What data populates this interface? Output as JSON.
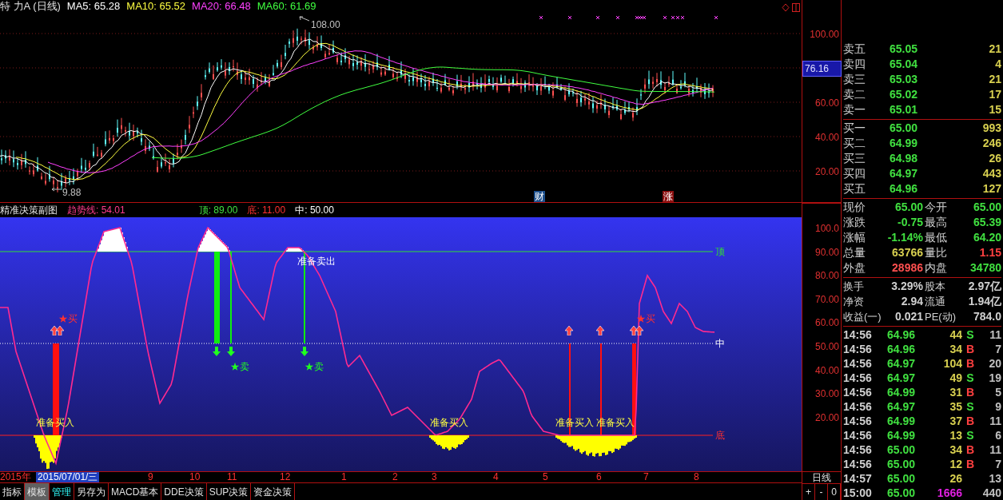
{
  "price_chart": {
    "header": [
      {
        "text": "特 力A (日线)",
        "color": "#e0e0e0"
      },
      {
        "text": "MA5: 65.28",
        "color": "#ffffff"
      },
      {
        "text": "MA10: 65.52",
        "color": "#ffff40"
      },
      {
        "text": "MA20: 66.48",
        "color": "#ff40ff"
      },
      {
        "text": "MA60: 61.69",
        "color": "#40ff40"
      }
    ],
    "high_label": "108.00",
    "low_label": "9.88",
    "event_tags": [
      {
        "text": "财",
        "color": "#1c4f8c"
      },
      {
        "text": "涨",
        "color": "#8c1010"
      }
    ],
    "axis_labels": [
      "100.00",
      "60.00",
      "40.00",
      "20.00"
    ],
    "current_price_tag": "76.16"
  },
  "indicator_chart": {
    "header": [
      {
        "text": "精准决策副图"
      },
      {
        "text": "趋势线: 54.01",
        "color": "#ff3c8c"
      },
      {
        "text": "顶: 89.00",
        "color": "#40e040"
      },
      {
        "text": "底: 11.00",
        "color": "#ff3030"
      },
      {
        "text": "中: 50.00",
        "color": "#ffffff"
      }
    ],
    "line_labels": [
      {
        "kind": "top",
        "text": "顶"
      },
      {
        "kind": "middle",
        "text": "中"
      },
      {
        "kind": "bottom",
        "text": "底"
      }
    ],
    "annotations": [
      {
        "kind": "prep_sell",
        "text": "准备卖出"
      },
      {
        "kind": "prep_buy",
        "text": "准备买入"
      },
      {
        "kind": "prep_buy",
        "text": "准备买入"
      },
      {
        "kind": "prep_buy",
        "text": "准备买入"
      },
      {
        "kind": "prep_buy",
        "text": "准备买入"
      },
      {
        "kind": "sell",
        "text": "★卖"
      },
      {
        "kind": "sell",
        "text": "★卖"
      },
      {
        "kind": "buy",
        "text": "★买"
      },
      {
        "kind": "buy",
        "text": "★买"
      }
    ],
    "axis_labels": [
      "100.0",
      "90.00",
      "80.00",
      "70.00",
      "60.00",
      "50.00",
      "40.00",
      "30.00",
      "20.00"
    ]
  },
  "x_axis": {
    "year": "2015年",
    "cursor_date": "2015/07/01/三",
    "months": [
      "9",
      "10",
      "11",
      "12",
      "1",
      "2",
      "3",
      "4",
      "5",
      "6",
      "7",
      "8"
    ]
  },
  "period_control": {
    "label": "日线",
    "buttons": [
      "+",
      "-",
      "0"
    ]
  },
  "bottom_tabs": [
    {
      "label": "指标",
      "selected": false,
      "active": false
    },
    {
      "label": "模板",
      "selected": true,
      "active": false
    },
    {
      "label": "管理",
      "selected": false,
      "active": true
    },
    {
      "label": "另存为",
      "selected": false,
      "active": false
    },
    {
      "label": "MACD基本",
      "selected": false,
      "active": false
    },
    {
      "label": "DDE决策",
      "selected": false,
      "active": false
    },
    {
      "label": "SUP决策",
      "selected": false,
      "active": false
    },
    {
      "label": "资金决策",
      "selected": false,
      "active": false
    }
  ],
  "order_book": {
    "asks": [
      {
        "label": "卖五",
        "price": "65.05",
        "volume": "21"
      },
      {
        "label": "卖四",
        "price": "65.04",
        "volume": "4"
      },
      {
        "label": "卖三",
        "price": "65.03",
        "volume": "21"
      },
      {
        "label": "卖二",
        "price": "65.02",
        "volume": "17"
      },
      {
        "label": "卖一",
        "price": "65.01",
        "volume": "15"
      }
    ],
    "bids": [
      {
        "label": "买一",
        "price": "65.00",
        "volume": "993"
      },
      {
        "label": "买二",
        "price": "64.99",
        "volume": "246"
      },
      {
        "label": "买三",
        "price": "64.98",
        "volume": "26"
      },
      {
        "label": "买四",
        "price": "64.97",
        "volume": "443"
      },
      {
        "label": "买五",
        "price": "64.96",
        "volume": "127"
      }
    ]
  },
  "quote": [
    {
      "label": "现价",
      "value": "65.00",
      "color": "#40e040"
    },
    {
      "label": "今开",
      "value": "65.00",
      "color": "#40e040"
    },
    {
      "label": "涨跌",
      "value": "-0.75",
      "color": "#40e040"
    },
    {
      "label": "最高",
      "value": "65.39",
      "color": "#40e040"
    },
    {
      "label": "涨幅",
      "value": "-1.14%",
      "color": "#40e040"
    },
    {
      "label": "最低",
      "value": "64.20",
      "color": "#40e040"
    },
    {
      "label": "总量",
      "value": "63766",
      "color": "#d8d050"
    },
    {
      "label": "量比",
      "value": "1.15",
      "color": "#ff4040"
    },
    {
      "label": "外盘",
      "value": "28986",
      "color": "#ff5050"
    },
    {
      "label": "内盘",
      "value": "34780",
      "color": "#40e040"
    }
  ],
  "fundamentals": [
    {
      "label": "换手",
      "value": "3.29%",
      "label2": "股本",
      "value2": "2.97亿"
    },
    {
      "label": "净资",
      "value": "2.94",
      "label2": "流通",
      "value2": "1.94亿"
    },
    {
      "label": "收益(一)",
      "value": "0.021",
      "label2": "PE(动)",
      "value2": "784.0"
    }
  ],
  "trades": [
    {
      "time": "14:56",
      "price": "64.96",
      "volume": "44",
      "side": "S",
      "count": "11",
      "kind": "trade"
    },
    {
      "time": "14:56",
      "price": "64.96",
      "volume": "34",
      "side": "B",
      "count": "7",
      "kind": "trade"
    },
    {
      "time": "14:56",
      "price": "64.97",
      "volume": "104",
      "side": "B",
      "count": "20",
      "kind": "trade"
    },
    {
      "time": "14:56",
      "price": "64.97",
      "volume": "49",
      "side": "S",
      "count": "19",
      "kind": "trade"
    },
    {
      "time": "14:56",
      "price": "64.99",
      "volume": "31",
      "side": "B",
      "count": "5",
      "kind": "trade"
    },
    {
      "time": "14:56",
      "price": "64.97",
      "volume": "35",
      "side": "S",
      "count": "9",
      "kind": "trade"
    },
    {
      "time": "14:56",
      "price": "64.99",
      "volume": "37",
      "side": "B",
      "count": "11",
      "kind": "trade"
    },
    {
      "time": "14:56",
      "price": "64.99",
      "volume": "13",
      "side": "S",
      "count": "6",
      "kind": "trade"
    },
    {
      "time": "14:56",
      "price": "65.00",
      "volume": "34",
      "side": "B",
      "count": "11",
      "kind": "trade"
    },
    {
      "time": "14:56",
      "price": "65.00",
      "volume": "12",
      "side": "B",
      "count": "7",
      "kind": "trade"
    },
    {
      "time": "14:57",
      "price": "65.00",
      "volume": "26",
      "count": "13",
      "kind": "trade"
    },
    {
      "time": "15:00",
      "price": "65.00",
      "volume": "1666",
      "count": "440",
      "kind": "close"
    }
  ]
}
